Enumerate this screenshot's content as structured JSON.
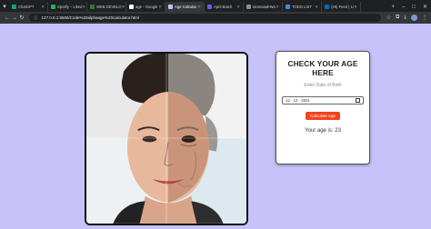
{
  "browser": {
    "tabs": [
      {
        "label": "ChatGPT",
        "color": "#10a37f",
        "active": false
      },
      {
        "label": "Spotify – Liked",
        "color": "#1db954",
        "active": false
      },
      {
        "label": "WEB DEVELO",
        "color": "#2e7d32",
        "active": false
      },
      {
        "label": "age - Google",
        "color": "#ffffff",
        "active": false
      },
      {
        "label": "Age Calculat",
        "color": "#c7c2f9",
        "active": true
      },
      {
        "label": "April Batch",
        "color": "#6c5ce7",
        "active": false
      },
      {
        "label": "tanmaiad•Wa",
        "color": "#8e8e8e",
        "active": false
      },
      {
        "label": "TODO LIST",
        "color": "#4285f4",
        "active": false
      },
      {
        "label": "(26) Feed | Li",
        "color": "#0a66c2",
        "active": false
      }
    ],
    "url": "127.0.0.1:5500/Code%20alphaage%20calculator.html"
  },
  "app": {
    "title": "CHECK YOUR AGE HERE",
    "subtitle": "Enter Date of Birth",
    "date_value": "12 - 12 - 2001",
    "button_label": "Calculate Age",
    "result": "Your age is: 23"
  },
  "colors": {
    "page_background": "#c7c2f9",
    "button": "#f2431d"
  }
}
